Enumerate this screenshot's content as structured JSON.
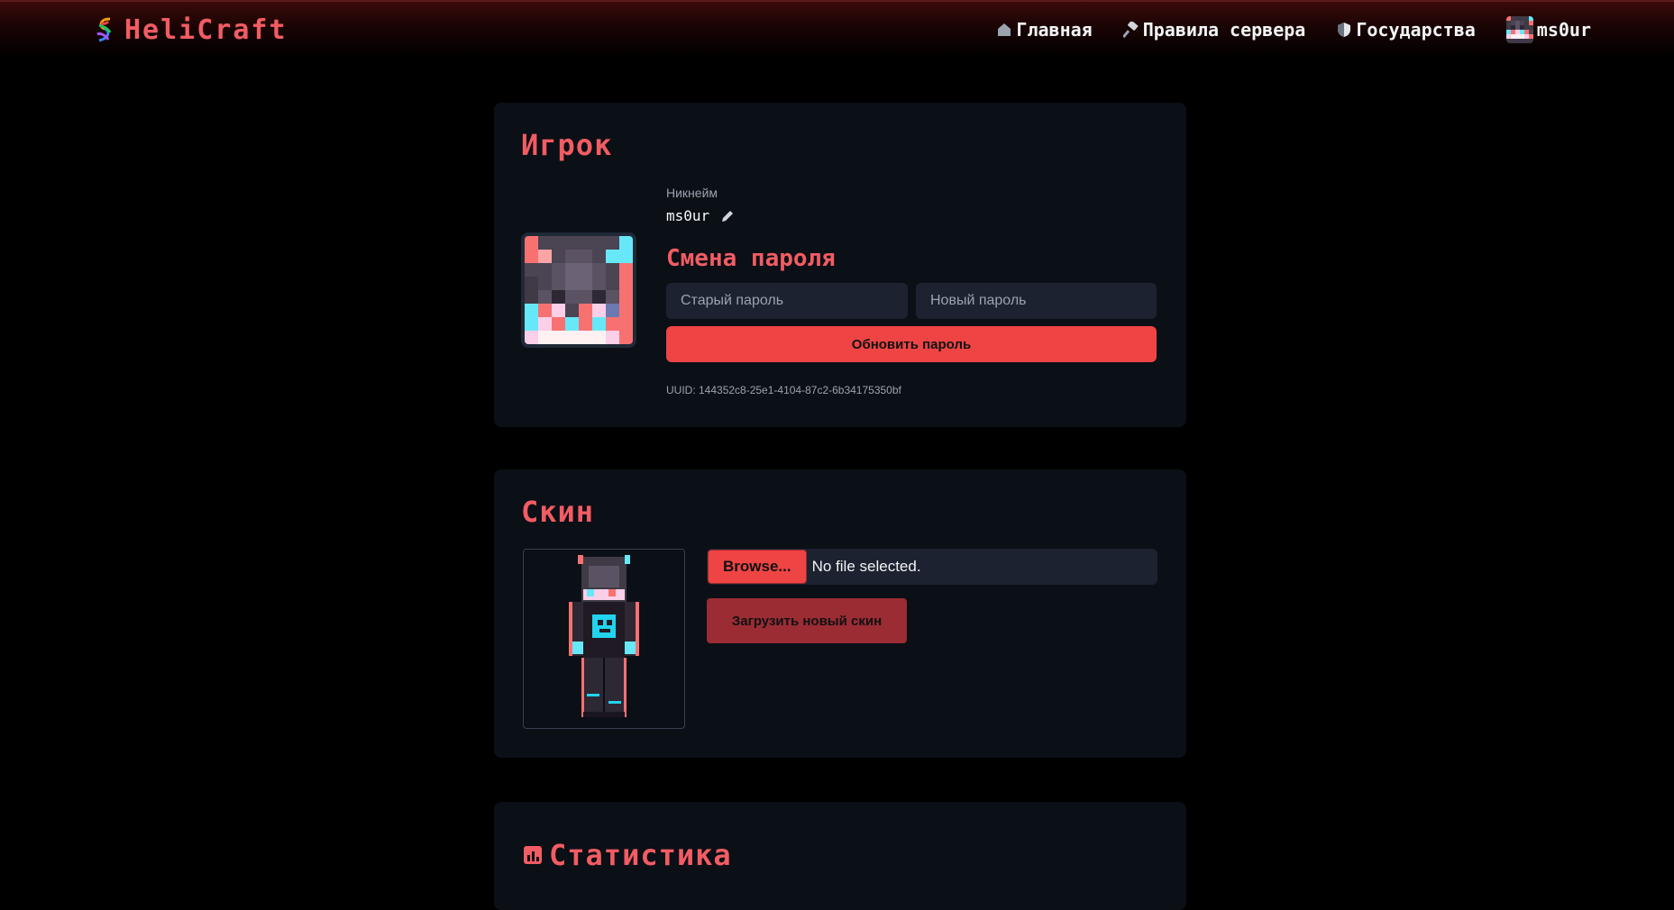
{
  "header": {
    "logo_text": "HeliCraft",
    "nav": [
      {
        "label": "Главная",
        "icon": "home-icon"
      },
      {
        "label": "Правила сервера",
        "icon": "hammer-icon"
      },
      {
        "label": "Государства",
        "icon": "shield-icon"
      },
      {
        "label": "ms0ur",
        "icon": "user-avatar"
      }
    ]
  },
  "player": {
    "title": "Игрок",
    "nickname_label": "Никнейм",
    "nickname": "ms0ur",
    "password_title": "Смена пароля",
    "old_password_placeholder": "Старый пароль",
    "new_password_placeholder": "Новый пароль",
    "update_button": "Обновить пароль",
    "uuid": "UUID: 144352c8-25e1-4104-87c2-6b34175350bf"
  },
  "skin": {
    "title": "Скин",
    "browse_button": "Browse...",
    "file_status": "No file selected.",
    "upload_button": "Загрузить новый скин"
  },
  "stats": {
    "title": "Статистика"
  },
  "colors": {
    "accent": "#f25c63",
    "button_red": "#ef4444",
    "card_bg": "#0b0f16",
    "page_bg": "#000000"
  }
}
